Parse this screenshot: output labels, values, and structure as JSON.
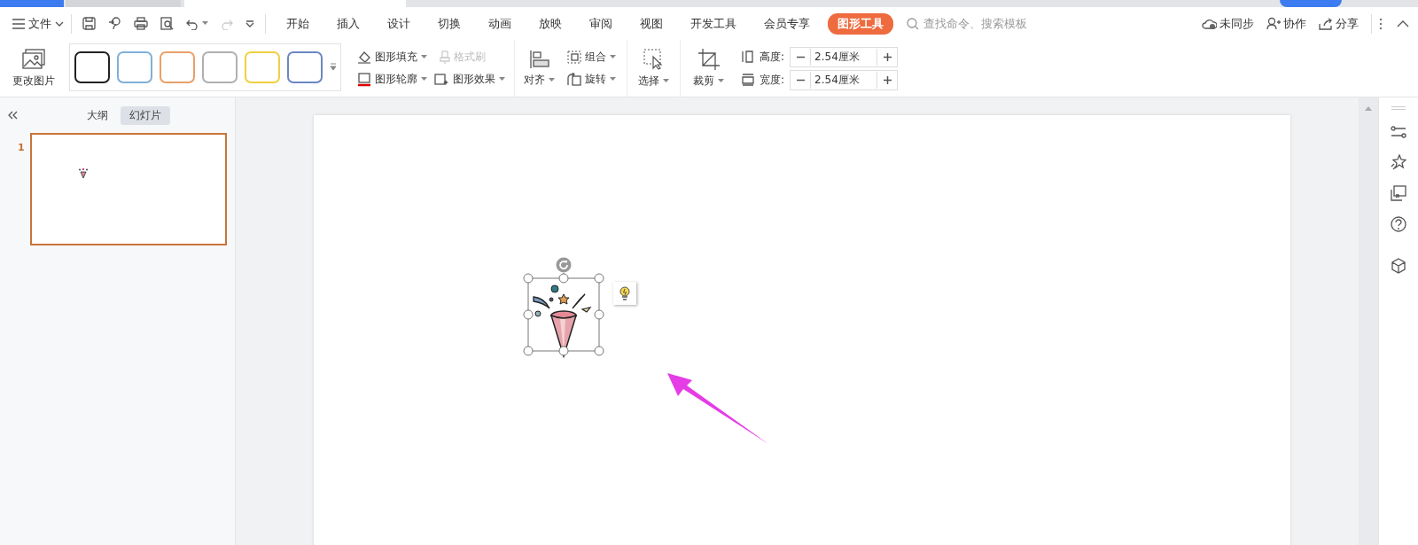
{
  "file_menu": {
    "label": "文件"
  },
  "menu_tabs": [
    {
      "label": "开始",
      "selected": false
    },
    {
      "label": "插入",
      "selected": false
    },
    {
      "label": "设计",
      "selected": false
    },
    {
      "label": "切换",
      "selected": false
    },
    {
      "label": "动画",
      "selected": false
    },
    {
      "label": "放映",
      "selected": false
    },
    {
      "label": "审阅",
      "selected": false
    },
    {
      "label": "视图",
      "selected": false
    },
    {
      "label": "开发工具",
      "selected": false
    },
    {
      "label": "会员专享",
      "selected": false
    },
    {
      "label": "图形工具",
      "selected": true
    }
  ],
  "search": {
    "placeholder": "查找命令、搜索模板"
  },
  "header_actions": [
    {
      "kind": "sync",
      "label": "未同步"
    },
    {
      "kind": "collab",
      "label": "协作"
    },
    {
      "kind": "share",
      "label": "分享"
    }
  ],
  "ribbon": {
    "change_picture": "更改图片",
    "style_swatches": [
      {
        "color": "#222222"
      },
      {
        "color": "#7fb0d9"
      },
      {
        "color": "#e9a06a"
      },
      {
        "color": "#b0b0b0"
      },
      {
        "color": "#f0d040"
      },
      {
        "color": "#6b86c2"
      }
    ],
    "fill": "图形填充",
    "format_painter": {
      "label": "格式刷",
      "disabled": true
    },
    "outline": "图形轮廓",
    "effect": "图形效果",
    "align": "对齐",
    "group": "组合",
    "rotate": "旋转",
    "select": "选择",
    "crop": "裁剪",
    "height": {
      "label": "高度:",
      "value": "2.54厘米"
    },
    "width": {
      "label": "宽度:",
      "value": "2.54厘米"
    }
  },
  "left_panel": {
    "tabs": [
      {
        "label": "大纲",
        "selected": false
      },
      {
        "label": "幻灯片",
        "selected": true
      }
    ],
    "slides": [
      {
        "number": "1",
        "selected": true
      }
    ]
  }
}
